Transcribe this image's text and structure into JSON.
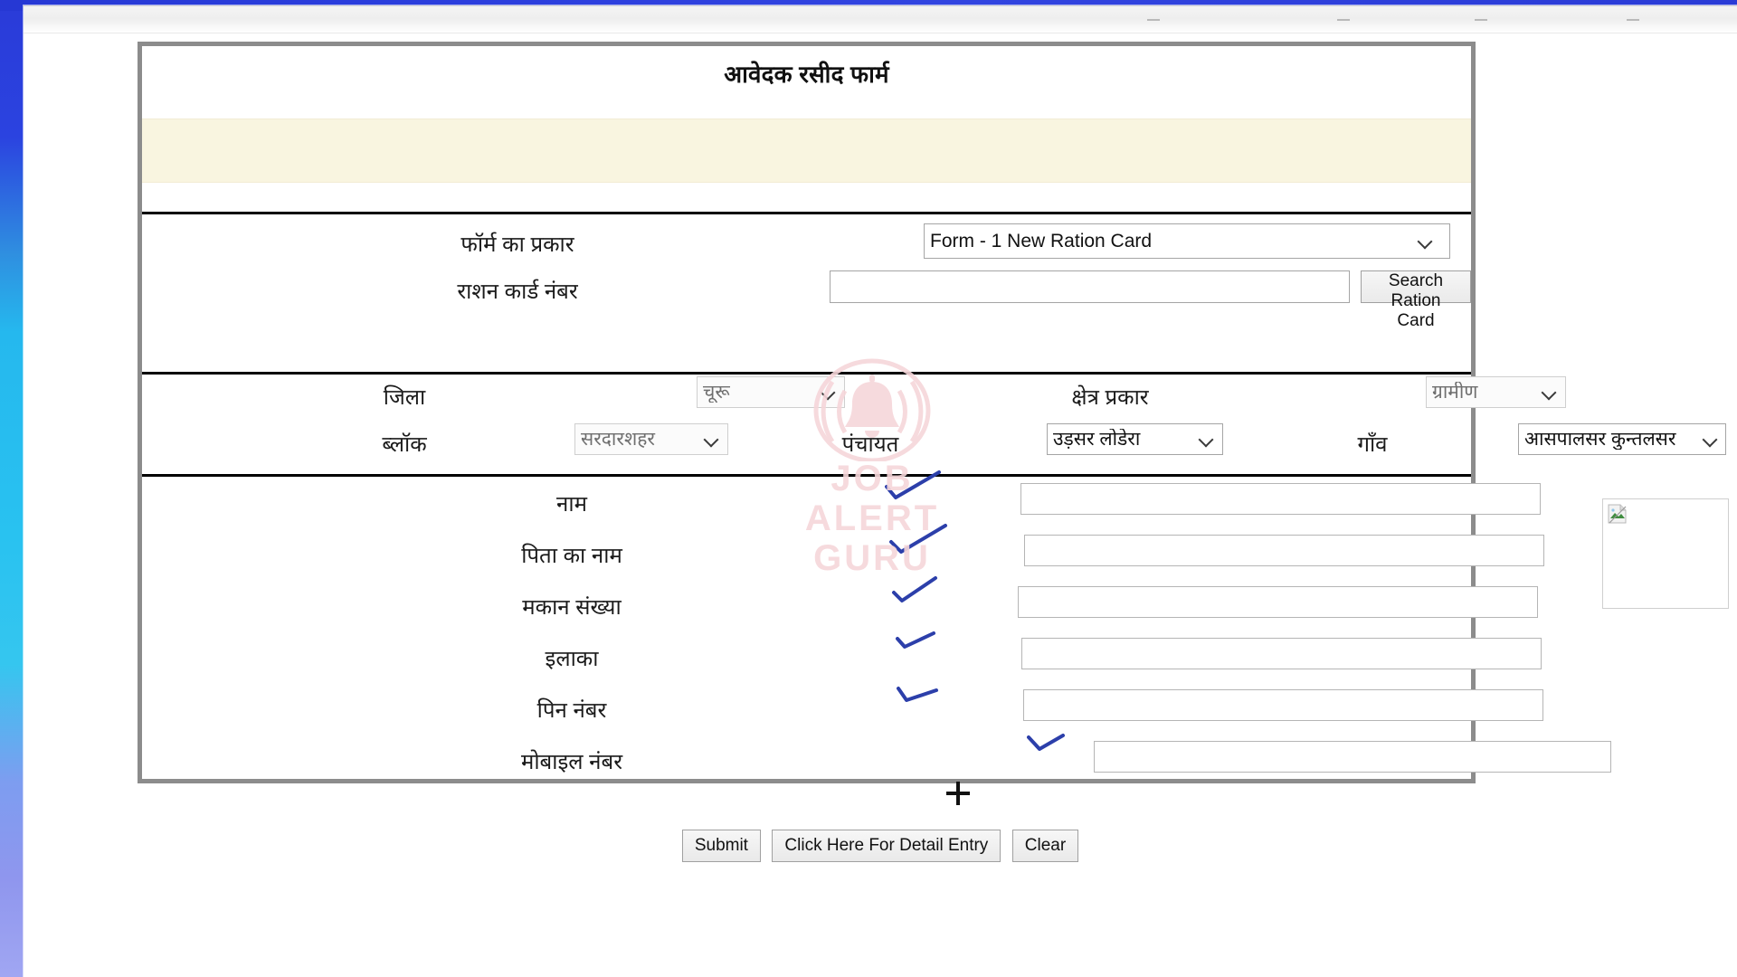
{
  "page": {
    "title": "आवेदक रसीद फार्म"
  },
  "top_section": {
    "form_type_label": "फॉर्म का प्रकार",
    "form_type_value": "Form - 1 New Ration Card",
    "form_type_options": [
      "Form - 1 New Ration Card"
    ],
    "ration_card_label": "राशन कार्ड नंबर",
    "ration_card_value": "",
    "ration_card_placeholder": "",
    "search_button_label": "Search Ration Card"
  },
  "location": {
    "district_label": "जिला",
    "district_value": "चूरू",
    "area_type_label": "क्षेत्र प्रकार",
    "area_type_value": "ग्रामीण",
    "block_label": "ब्लॉक",
    "block_value": "सरदारशहर",
    "panchayat_label": "पंचायत",
    "panchayat_value": "उड़सर लोडेरा",
    "village_label": "गाँव",
    "village_value": "आसपालसर कुन्तलसर"
  },
  "fields": [
    {
      "label": "नाम",
      "value": ""
    },
    {
      "label": "पिता का नाम",
      "value": ""
    },
    {
      "label": "मकान संख्या",
      "value": ""
    },
    {
      "label": "इलाका",
      "value": ""
    },
    {
      "label": "पिन नंबर",
      "value": ""
    },
    {
      "label": "मोबाइल नंबर",
      "value": ""
    }
  ],
  "buttons": {
    "submit": "Submit",
    "detail_entry": "Click Here For Detail Entry",
    "clear": "Clear"
  },
  "watermark": {
    "line1": "JOB",
    "line2": "ALERT",
    "line3": "GURU",
    "color": "#f6d6da",
    "icon": "bell-icon"
  },
  "colors": {
    "panel_border": "#8c8c8c",
    "notice_banner": "#f9f5e0",
    "rule": "#000000",
    "scribble_ink": "#2c3faa",
    "wallpaper_blue": "#2a3bd8",
    "wallpaper_cyan": "#29c2f0"
  }
}
